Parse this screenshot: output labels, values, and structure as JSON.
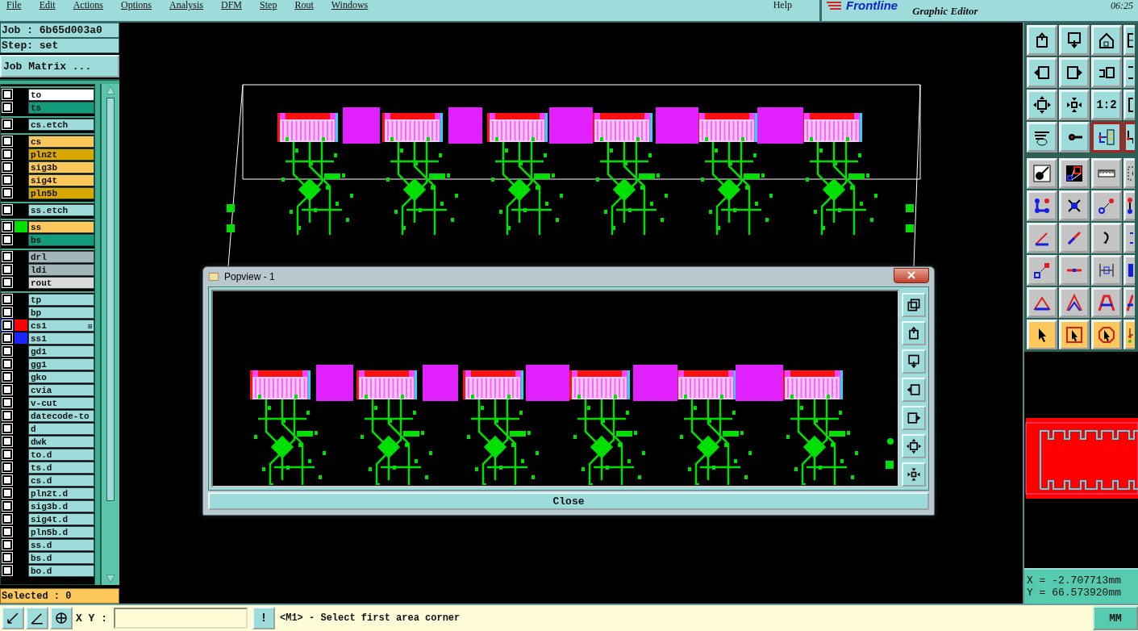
{
  "menu": [
    "File",
    "Edit",
    "Actions",
    "Options",
    "Analysis",
    "DFM",
    "Step",
    "Rout",
    "Windows"
  ],
  "help": "Help",
  "logo": {
    "name": "Frontline",
    "subtitle": "Graphic Editor"
  },
  "clock": "06:25",
  "job": "Job : 6b65d003a0",
  "step": "Step: set",
  "job_matrix_button": "Job Matrix ...",
  "layer_groups": [
    {
      "layers": [
        {
          "name": "to",
          "color": "#ffffff",
          "checked": false
        },
        {
          "name": "ts",
          "color": "#129c7c",
          "checked": false
        }
      ]
    },
    {
      "layers": [
        {
          "name": "cs.etch",
          "color": "#9edcdc",
          "checked": false
        }
      ]
    },
    {
      "layers": [
        {
          "name": "cs",
          "color": "#fcc85c",
          "checked": false
        },
        {
          "name": "pln2t",
          "color": "#d9a800",
          "checked": false
        },
        {
          "name": "sig3b",
          "color": "#fcc85c",
          "checked": false
        },
        {
          "name": "sig4t",
          "color": "#fcc85c",
          "checked": false
        },
        {
          "name": "pln5b",
          "color": "#d9a800",
          "checked": false
        }
      ]
    },
    {
      "layers": [
        {
          "name": "ss.etch",
          "color": "#9edcdc",
          "checked": false
        }
      ]
    },
    {
      "layers": [
        {
          "name": "ss",
          "color": "#fcc85c",
          "checked": false,
          "swatch": {
            "color": "#00e000"
          }
        },
        {
          "name": "bs",
          "color": "#129c7c",
          "checked": false
        }
      ]
    },
    {
      "layers": [
        {
          "name": "drl",
          "color": "#a2b6ba",
          "checked": false
        },
        {
          "name": "ldi",
          "color": "#a2b6ba",
          "checked": false
        },
        {
          "name": "rout",
          "color": "#dadada",
          "checked": false
        }
      ]
    },
    {
      "layers": [
        {
          "name": "tp",
          "color": "#9edcdc",
          "checked": false
        },
        {
          "name": "bp",
          "color": "#9edcdc",
          "checked": false
        },
        {
          "name": "cs1",
          "color": "#9edcdc",
          "checked": false,
          "active": true,
          "swatch": {
            "color": "#ff0000"
          },
          "marker": "⊞"
        },
        {
          "name": "ss1",
          "color": "#9edcdc",
          "checked": false,
          "swatch": {
            "color": "#1c24ff"
          }
        },
        {
          "name": "gd1",
          "color": "#9edcdc",
          "checked": false
        },
        {
          "name": "gg1",
          "color": "#9edcdc",
          "checked": false
        },
        {
          "name": "gko",
          "color": "#9edcdc",
          "checked": false
        },
        {
          "name": "cvia",
          "color": "#9edcdc",
          "checked": false
        },
        {
          "name": "v-cut",
          "color": "#9edcdc",
          "checked": false
        },
        {
          "name": "datecode-to",
          "color": "#9edcdc",
          "checked": false
        },
        {
          "name": "d",
          "color": "#9edcdc",
          "checked": false
        },
        {
          "name": "dwk",
          "color": "#9edcdc",
          "checked": false
        },
        {
          "name": "to.d",
          "color": "#9edcdc",
          "checked": false
        },
        {
          "name": "ts.d",
          "color": "#9edcdc",
          "checked": false
        },
        {
          "name": "cs.d",
          "color": "#9edcdc",
          "checked": false
        },
        {
          "name": "pln2t.d",
          "color": "#9edcdc",
          "checked": false
        },
        {
          "name": "sig3b.d",
          "color": "#9edcdc",
          "checked": false
        },
        {
          "name": "sig4t.d",
          "color": "#9edcdc",
          "checked": false
        },
        {
          "name": "pln5b.d",
          "color": "#9edcdc",
          "checked": false
        },
        {
          "name": "ss.d",
          "color": "#9edcdc",
          "checked": false
        },
        {
          "name": "bs.d",
          "color": "#9edcdc",
          "checked": false
        },
        {
          "name": "bo.d",
          "color": "#9edcdc",
          "checked": false
        }
      ]
    }
  ],
  "selected_count": "Selected : 0",
  "popview": {
    "title": "Popview - 1",
    "close_button": "Close"
  },
  "tools": [
    {
      "kind": "view",
      "selected": false
    },
    {
      "kind": "view",
      "selected": false
    },
    {
      "kind": "view",
      "selected": false
    },
    {
      "kind": "view",
      "selected": false
    },
    {
      "kind": "view",
      "selected": false
    },
    {
      "kind": "view",
      "selected": false
    },
    {
      "kind": "view",
      "selected": false
    },
    {
      "kind": "view",
      "selected": false
    },
    {
      "kind": "view",
      "selected": false
    },
    {
      "kind": "view",
      "selected": false
    },
    {
      "kind": "view",
      "selected": false,
      "label": "1:2"
    },
    {
      "kind": "view",
      "selected": false
    },
    {
      "kind": "view",
      "selected": false
    },
    {
      "kind": "view",
      "selected": false
    },
    {
      "kind": "view",
      "selected": true
    },
    {
      "kind": "view",
      "selected": true
    },
    {
      "kind": "edit",
      "selected": false
    },
    {
      "kind": "edit",
      "selected": false
    },
    {
      "kind": "edit",
      "selected": false
    },
    {
      "kind": "edit",
      "selected": false
    },
    {
      "kind": "edit",
      "selected": false
    },
    {
      "kind": "edit",
      "selected": false
    },
    {
      "kind": "edit",
      "selected": false
    },
    {
      "kind": "edit",
      "selected": false
    },
    {
      "kind": "edit",
      "selected": false
    },
    {
      "kind": "edit",
      "selected": false
    },
    {
      "kind": "edit",
      "selected": false
    },
    {
      "kind": "edit",
      "selected": false
    },
    {
      "kind": "edit",
      "selected": false
    },
    {
      "kind": "edit",
      "selected": false
    },
    {
      "kind": "edit",
      "selected": false
    },
    {
      "kind": "edit",
      "selected": false
    },
    {
      "kind": "edit",
      "selected": false
    },
    {
      "kind": "edit",
      "selected": false
    },
    {
      "kind": "edit",
      "selected": false
    },
    {
      "kind": "edit",
      "selected": false
    },
    {
      "kind": "select",
      "selected": false
    },
    {
      "kind": "select",
      "selected": false
    },
    {
      "kind": "select",
      "selected": false
    },
    {
      "kind": "select",
      "selected": false
    }
  ],
  "coordinates": {
    "x": "X = -2.707713mm",
    "y": "Y = 66.573920mm"
  },
  "status_bar": {
    "xy_label": "X Y :",
    "alert_button": "!",
    "message": "<M1> - Select first area corner",
    "units_button": "MM"
  }
}
